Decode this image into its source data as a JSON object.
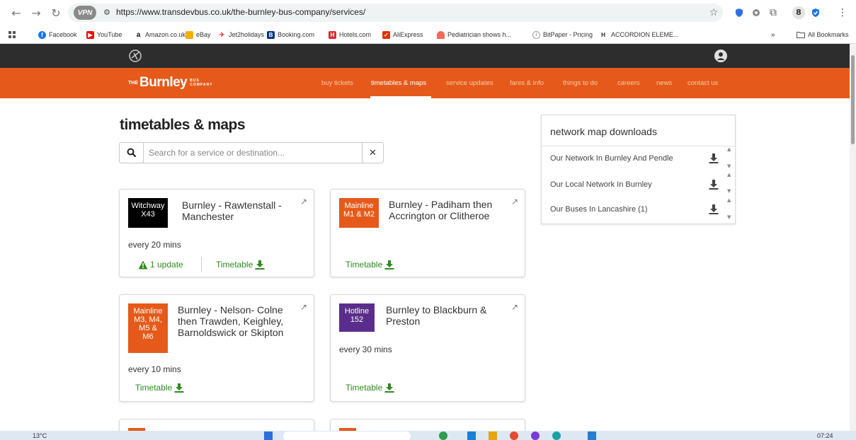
{
  "browser": {
    "url": "https://www.transdevbus.co.uk/the-burnley-bus-company/services/",
    "vpn_label": "VPN",
    "bookmarks": [
      {
        "label": "Facebook",
        "icon": "facebook-icon",
        "color": "#1877f2"
      },
      {
        "label": "YouTube",
        "icon": "youtube-icon",
        "color": "#ff0000"
      },
      {
        "label": "Amazon.co.uk",
        "icon": "amazon-icon",
        "color": "#111111"
      },
      {
        "label": "eBay",
        "icon": "ebay-icon",
        "color": "#e53238"
      },
      {
        "label": "Jet2holidays",
        "icon": "jet2-icon",
        "color": "#e3342f"
      },
      {
        "label": "Booking.com",
        "icon": "booking-icon",
        "color": "#003580"
      },
      {
        "label": "Hotels.com",
        "icon": "hotels-icon",
        "color": "#d32f2f"
      },
      {
        "label": "AliExpress",
        "icon": "aliexpress-icon",
        "color": "#e62e04"
      },
      {
        "label": "Pediatrician shows h...",
        "icon": "pediatrician-icon",
        "color": "#ef6c57"
      },
      {
        "label": "BitPaper - Pricing",
        "icon": "bitpaper-icon",
        "color": "#9e9e9e"
      },
      {
        "label": "ACCORDION ELEME...",
        "icon": "hp-icon",
        "color": "#222222"
      }
    ],
    "more_bookmarks": "»",
    "all_bookmarks": "All Bookmarks",
    "profile_letter": "8"
  },
  "site": {
    "brand_prefix": "THE",
    "brand_name": "Burnley",
    "brand_suffix_1": "BUS",
    "brand_suffix_2": "COMPANY",
    "nav": [
      "buy tickets",
      "timetables & maps",
      "service updates",
      "fares & info",
      "things to do",
      "careers",
      "news",
      "contact us"
    ],
    "active_nav": "timetables & maps",
    "accent": "#e55a1a",
    "green": "#2e8b1e"
  },
  "main": {
    "title": "timetables & maps",
    "search_placeholder": "Search for a service or destination...",
    "search_value": "",
    "clear_label": "✕",
    "timetable_label": "Timetable",
    "cards": [
      {
        "badge": [
          "Witchway",
          "X43"
        ],
        "badge_color": "#000000",
        "title": "Burnley - Rawtenstall - Manchester",
        "freq": "every 20 mins",
        "update": "1 update"
      },
      {
        "badge": [
          "Mainline",
          "M1 & M2"
        ],
        "badge_color": "#e55a1a",
        "title": "Burnley - Padiham then Accrington or Clitheroe",
        "freq": "",
        "update": ""
      },
      {
        "badge": [
          "Mainline",
          "M3, M4,",
          "M5 &",
          "M6"
        ],
        "badge_color": "#e55a1a",
        "title": "Burnley - Nelson- Colne then Trawden, Keighley, Barnoldswick or Skipton",
        "freq": "every 10 mins",
        "update": ""
      },
      {
        "badge": [
          "Hotline",
          "152"
        ],
        "badge_color": "#5a2d8c",
        "title": "Burnley to Blackburn & Preston",
        "freq": "every 30 mins",
        "update": ""
      }
    ]
  },
  "network": {
    "title": "network map downloads",
    "items": [
      "Our Network In Burnley And Pendle",
      "Our Local Network In Burnley",
      "Our Buses In Lancashire (1)"
    ]
  },
  "taskbar": {
    "weather": "13°C",
    "time": "07:24"
  }
}
